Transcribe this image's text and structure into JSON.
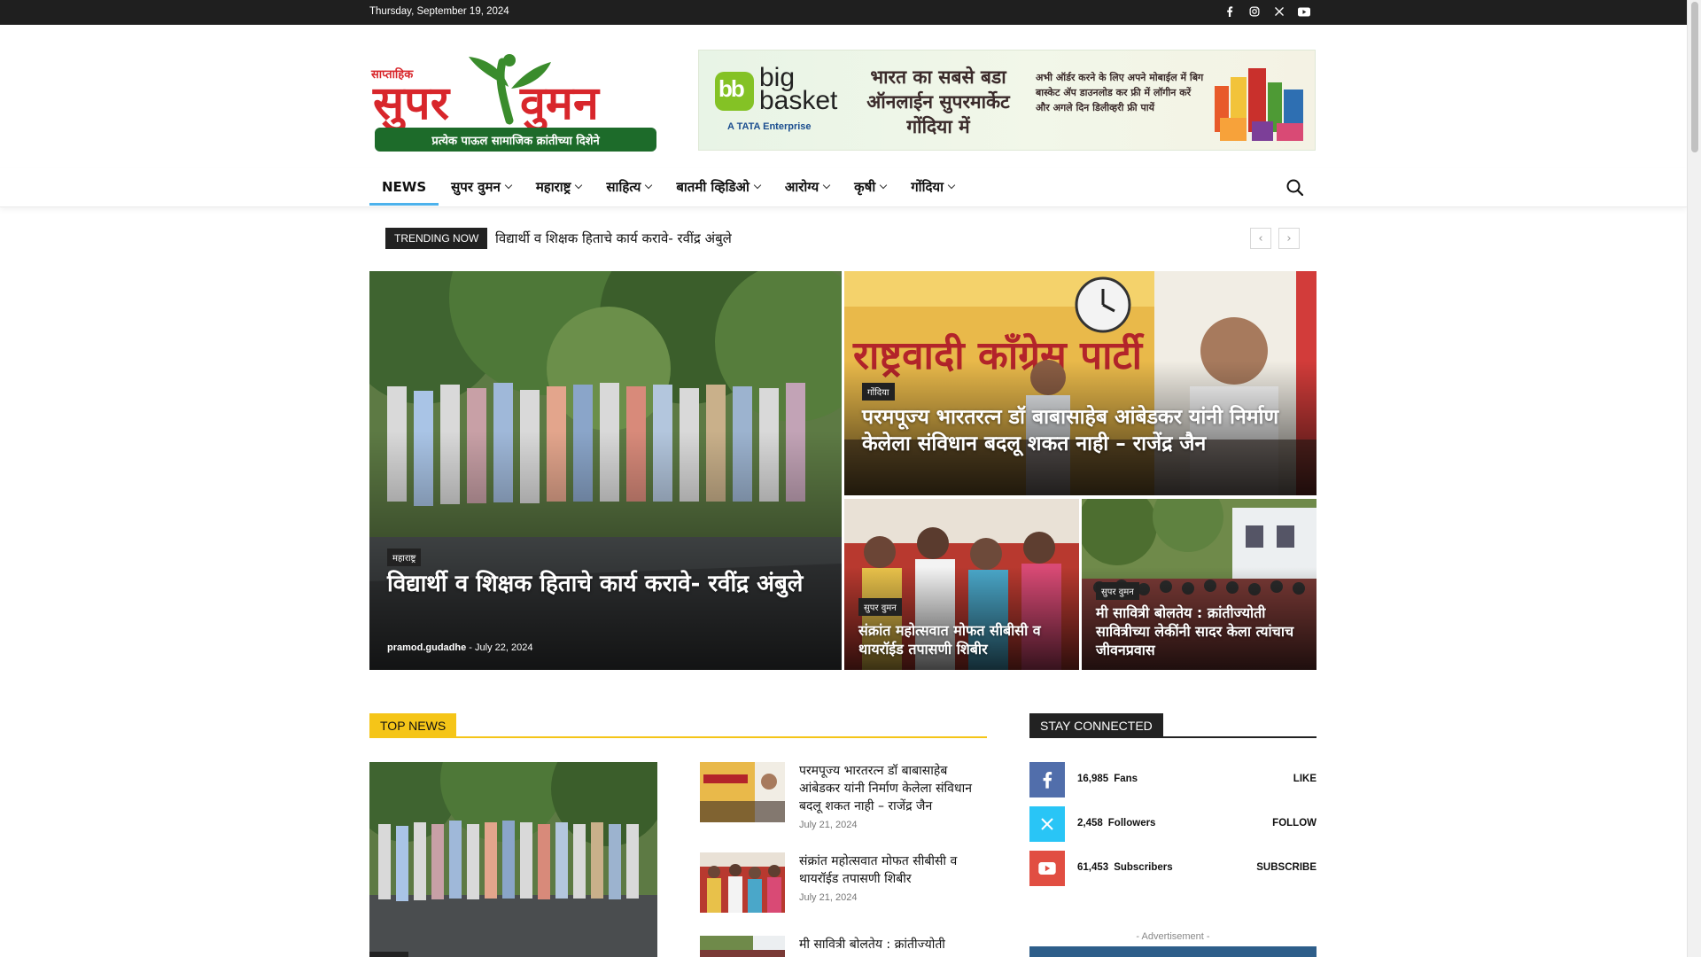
{
  "topbar": {
    "date": "Thursday, September 19, 2024",
    "socials": [
      "facebook-icon",
      "instagram-icon",
      "x-icon",
      "youtube-icon"
    ]
  },
  "logo": {
    "small_text": "साप्ताहिक",
    "main_text_left": "सुपर",
    "main_text_right": "वुमन",
    "tagline": "प्रत्येक पाऊल सामाजिक क्रांतीच्या दिशेने"
  },
  "banner": {
    "brand_mark": "bb",
    "brand_name_1": "big",
    "brand_name_2": "basket",
    "brand_sub": "A TATA Enterprise",
    "headline": "भारत का सबसे बडा ऑनलाईन सुपरमार्केट गोंदिया में",
    "subtext": "अभी ऑर्डर करने के लिए अपने मोबाईल में बिग बास्केट ॲप डाउनलोड कर फ्री में लॉगीन करें और अगले दिन डिलीव्हरी फ्री पायें"
  },
  "nav": {
    "items": [
      {
        "label": "NEWS",
        "dropdown": false,
        "active": true
      },
      {
        "label": "सुपर वुमन",
        "dropdown": true
      },
      {
        "label": "महाराष्ट्र",
        "dropdown": true
      },
      {
        "label": "साहित्य",
        "dropdown": true
      },
      {
        "label": "बातमी व्हिडिओ",
        "dropdown": true
      },
      {
        "label": "आरोग्य",
        "dropdown": true
      },
      {
        "label": "कृषी",
        "dropdown": true
      },
      {
        "label": "गोंदिया",
        "dropdown": true
      }
    ]
  },
  "trending": {
    "tag": "TRENDING NOW",
    "headline": "विद्यार्थी व शिक्षक हिताचे कार्य करावे- रवींद्र अंबुले",
    "prev": "‹",
    "next": "›"
  },
  "featured": {
    "main": {
      "category": "महाराष्ट्र",
      "title": "विद्यार्थी व शिक्षक हिताचे कार्य करावे- रवींद्र अंबुले",
      "author": "pramod.gudadhe",
      "separator": "-",
      "date": "July 22, 2024"
    },
    "top_right": {
      "category": "गोंदिया",
      "title": "परमपूज्य भारतरत्न डॉ बाबासाहेब आंबेडकर यांनी निर्माण केलेला संविधान बदलू शकत नाही – राजेंद्र जैन",
      "photo_sign": "राष्ट्रवादी काँग्रेस पार्टी"
    },
    "bottom_left": {
      "category": "सुपर वुमन",
      "title": "संक्रांत महोत्सवात मोफत सीबीसी व थायरॉईड तपासणी शिबीर"
    },
    "bottom_right": {
      "category": "सुपर वुमन",
      "title": "मी सावित्री बोलतेय : क्रांतीज्योती सावित्रीच्या लेकींनी सादर केला त्यांचाच जीवनप्रवास"
    }
  },
  "top_news": {
    "heading": "TOP NEWS",
    "items": [
      {
        "title": "परमपूज्य भारतरत्न डॉ बाबासाहेब आंबेडकर यांनी निर्माण केलेला संविधान बदलू शकत नाही – राजेंद्र जैन",
        "date": "July 21, 2024"
      },
      {
        "title": "संक्रांत महोत्सवात मोफत सीबीसी व थायरॉईड तपासणी शिबीर",
        "date": "July 21, 2024"
      },
      {
        "title": "मी सावित्री बोलतेय : क्रांतीज्योती",
        "date": ""
      }
    ]
  },
  "stay_connected": {
    "heading": "STAY CONNECTED",
    "rows": [
      {
        "icon": "facebook-icon",
        "count": "16,985",
        "unit": "Fans",
        "action": "LIKE",
        "color": "#516eab"
      },
      {
        "icon": "x-icon",
        "count": "2,458",
        "unit": "Followers",
        "action": "FOLLOW",
        "color": "#29c5f6"
      },
      {
        "icon": "youtube-icon",
        "count": "61,453",
        "unit": "Subscribers",
        "action": "SUBSCRIBE",
        "color": "#e14e42"
      }
    ],
    "ad_label": "- Advertisement -"
  },
  "colors": {
    "accent_blue": "#4db2ec",
    "accent_yellow": "#f5c518",
    "dark": "#222222",
    "logo_red": "#d8262b",
    "logo_green": "#3a8c2c"
  }
}
